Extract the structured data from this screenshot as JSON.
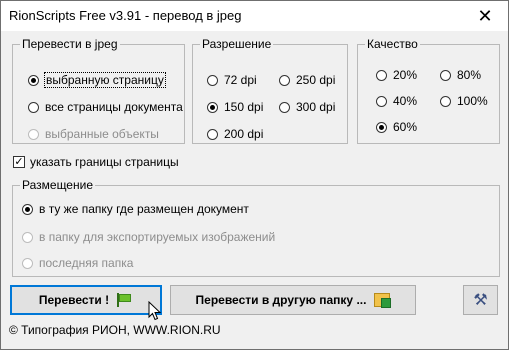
{
  "window": {
    "title": "RionScripts Free v3.91 - перевод в jpeg",
    "close_glyph": "✕"
  },
  "convert_group": {
    "legend": "Перевести в jpeg",
    "options": [
      {
        "label": "выбранную страницу",
        "selected": true,
        "enabled": true
      },
      {
        "label": "все страницы документа",
        "selected": false,
        "enabled": true
      },
      {
        "label": "выбранные объекты",
        "selected": false,
        "enabled": false
      }
    ]
  },
  "resolution_group": {
    "legend": "Разрешение",
    "options": [
      {
        "label": "72 dpi",
        "selected": false
      },
      {
        "label": "250 dpi",
        "selected": false
      },
      {
        "label": "150 dpi",
        "selected": true
      },
      {
        "label": "300 dpi",
        "selected": false
      },
      {
        "label": "200 dpi",
        "selected": false
      }
    ]
  },
  "quality_group": {
    "legend": "Качество",
    "options": [
      {
        "label": "20%",
        "selected": false
      },
      {
        "label": "80%",
        "selected": false
      },
      {
        "label": "40%",
        "selected": false
      },
      {
        "label": "100%",
        "selected": false
      },
      {
        "label": "60%",
        "selected": true
      }
    ]
  },
  "page_bounds_checkbox": {
    "label": "указать границы страницы",
    "checked": true,
    "mark": "✓"
  },
  "placement_group": {
    "legend": "Размещение",
    "options": [
      {
        "label": "в ту же папку где размещен документ",
        "selected": true,
        "enabled": true
      },
      {
        "label": "в папку для экспортируемых изображений",
        "selected": false,
        "enabled": false
      },
      {
        "label": "последняя папка",
        "selected": false,
        "enabled": false
      }
    ]
  },
  "buttons": {
    "convert": "Перевести !",
    "convert_other": "Перевести в другую папку ...",
    "settings_glyph": "⚒"
  },
  "footer": "© Типография РИОН,  WWW.RION.RU",
  "icons": {
    "convert": "green-flag-icon",
    "convert_other": "folder-export-icon",
    "settings": "tools-icon",
    "cursor": "mouse-pointer-icon"
  },
  "colors": {
    "focus_border": "#0078d7",
    "window_bg": "#f0f0f0",
    "flag_green": "#6cc12c"
  }
}
